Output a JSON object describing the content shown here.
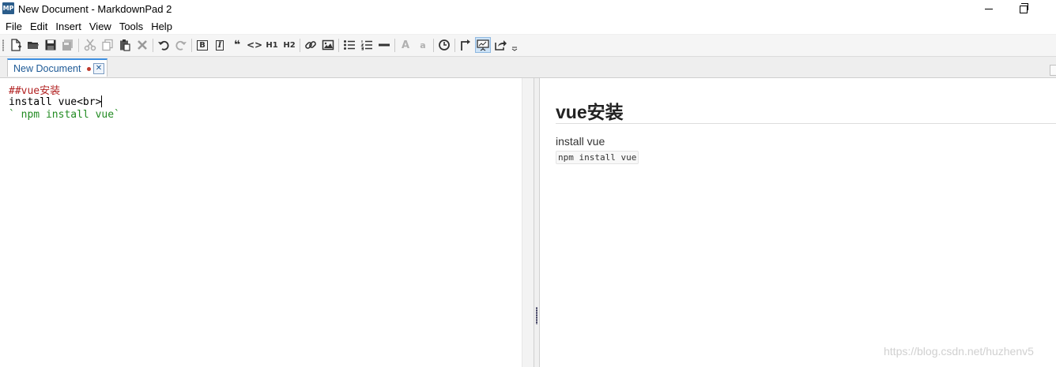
{
  "window": {
    "logo_text": "MP",
    "title": "New Document - MarkdownPad 2"
  },
  "menu": [
    "File",
    "Edit",
    "Insert",
    "View",
    "Tools",
    "Help"
  ],
  "toolbar": {
    "icons": [
      "new-document-icon",
      "open-folder-icon",
      "save-icon",
      "save-all-icon",
      "cut-icon",
      "copy-icon",
      "paste-icon",
      "delete-icon",
      "undo-icon",
      "redo-icon",
      "bold-icon",
      "italic-icon",
      "quote-icon",
      "code-icon",
      "heading1-icon",
      "heading2-icon",
      "link-icon",
      "image-icon",
      "unordered-list-icon",
      "ordered-list-icon",
      "horizontal-rule-icon",
      "uppercase-icon",
      "lowercase-icon",
      "timestamp-icon",
      "toggle-preview-icon",
      "live-preview-icon",
      "export-icon",
      "toolbar-overflow-icon"
    ],
    "bold_label": "B",
    "italic_label": "I",
    "quote_label": "❝",
    "code_label": "<>",
    "h1_label": "H1",
    "h2_label": "H2",
    "upper_label": "A",
    "lower_label": "a"
  },
  "tab": {
    "label": "New Document",
    "close": "✕"
  },
  "editor": {
    "line1": "##vue安装",
    "line2": "install vue<br>",
    "line3": "` npm install vue`"
  },
  "preview": {
    "heading": "vue安装",
    "text": "install vue",
    "code": "npm install vue"
  },
  "watermark": "https://blog.csdn.net/huzhenv5",
  "colors": {
    "accent": "#3c8ee0",
    "heading_md": "#b22222",
    "code_md": "#228b22"
  }
}
